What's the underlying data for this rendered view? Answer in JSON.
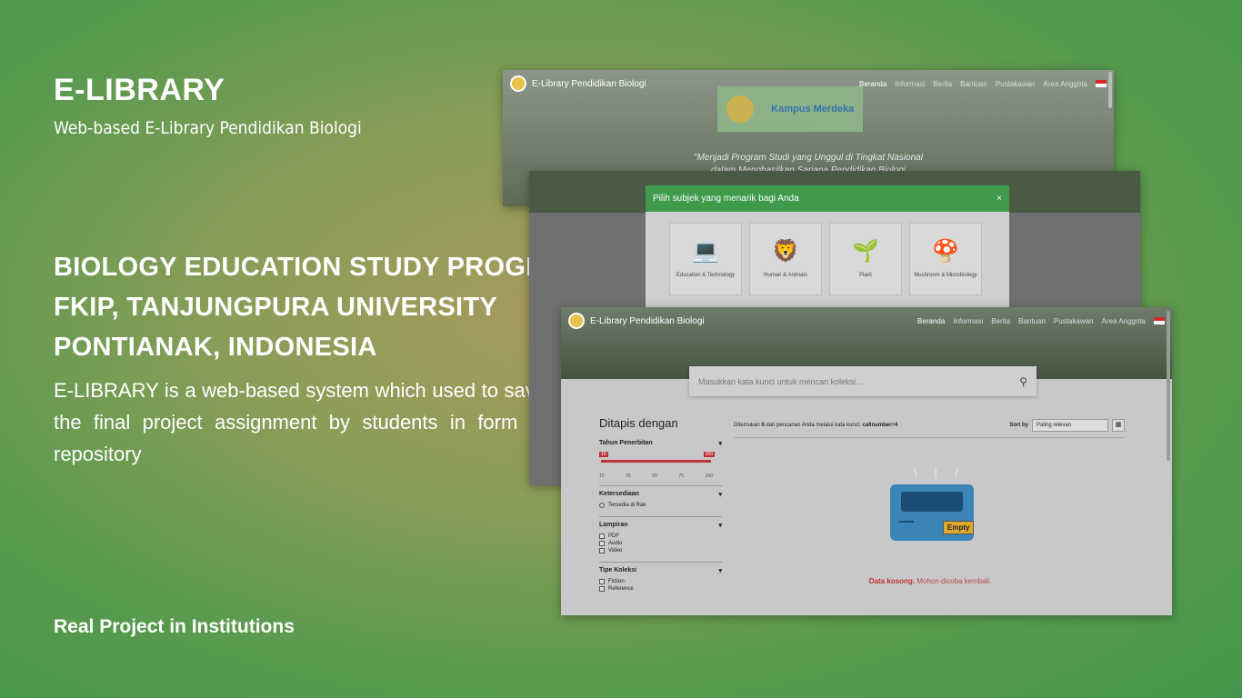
{
  "hero": {
    "title": "E-LIBRARY",
    "subtitle": "Web-based E-Library Pendidikan Biologi",
    "program_lines": [
      "BIOLOGY EDUCATION STUDY PROGRAM",
      "FKIP, TANJUNGPURA UNIVERSITY",
      "PONTIANAK, INDONESIA"
    ],
    "description": "E-LIBRARY is a web-based system which used to save the final project assignment by students in form of repository",
    "footer": "Real Project in Institutions"
  },
  "shot1": {
    "brand": "E-Library Pendidikan Biologi",
    "nav": [
      "Beranda",
      "Informasi",
      "Berita",
      "Bantuan",
      "Pustakawan",
      "Area Anggota"
    ],
    "banner_text": "Kampus Merdeka",
    "tagline1": "\"Menjadi Program Studi yang Unggul di Tingkat Nasional",
    "tagline2": "dalam Menghasilkan Sarjana Pendidikan Biologi"
  },
  "shot2": {
    "modal_title": "Pilih subjek yang menarik bagi Anda",
    "close": "×",
    "subjects": [
      {
        "label": "Education & Technology",
        "icon": "💻"
      },
      {
        "label": "Human & Animals",
        "icon": "🦁"
      },
      {
        "label": "Plant",
        "icon": "🌱"
      },
      {
        "label": "Mushroom & Microbiology",
        "icon": "🍄"
      }
    ]
  },
  "shot3": {
    "brand": "E-Library Pendidikan Biologi",
    "nav": [
      "Beranda",
      "Informasi",
      "Berita",
      "Bantuan",
      "Pustakawan",
      "Area Anggota"
    ],
    "search_placeholder": "Masukkan kata kunci untuk mencari koleksi...",
    "filter_title": "Ditapis dengan",
    "filters": {
      "tahun": "Tahun Penerbitan",
      "slider_min": "10",
      "slider_max": "100",
      "ticks": [
        "10",
        "25",
        "50",
        "75",
        "100"
      ],
      "ketersediaan": "Ketersediaan",
      "tersedia": "Tersedia di Rak",
      "lampiran": "Lampiran",
      "lampiran_opts": [
        "PDF",
        "Audio",
        "Video"
      ],
      "tipe": "Tipe Koleksi",
      "tipe_opts": [
        "Fiction",
        "Reference"
      ]
    },
    "results_prefix": "Ditemukan",
    "results_count": "0",
    "results_mid": "dari pencarian Anda melalui kata kunci:",
    "results_keyword": "callnumber=4",
    "sort_label": "Sort by",
    "sort_value": "Paling relevan",
    "empty_tag": "Empty",
    "empty_bold": "Data kosong.",
    "empty_rest": "Mohon dicoba kembali"
  }
}
